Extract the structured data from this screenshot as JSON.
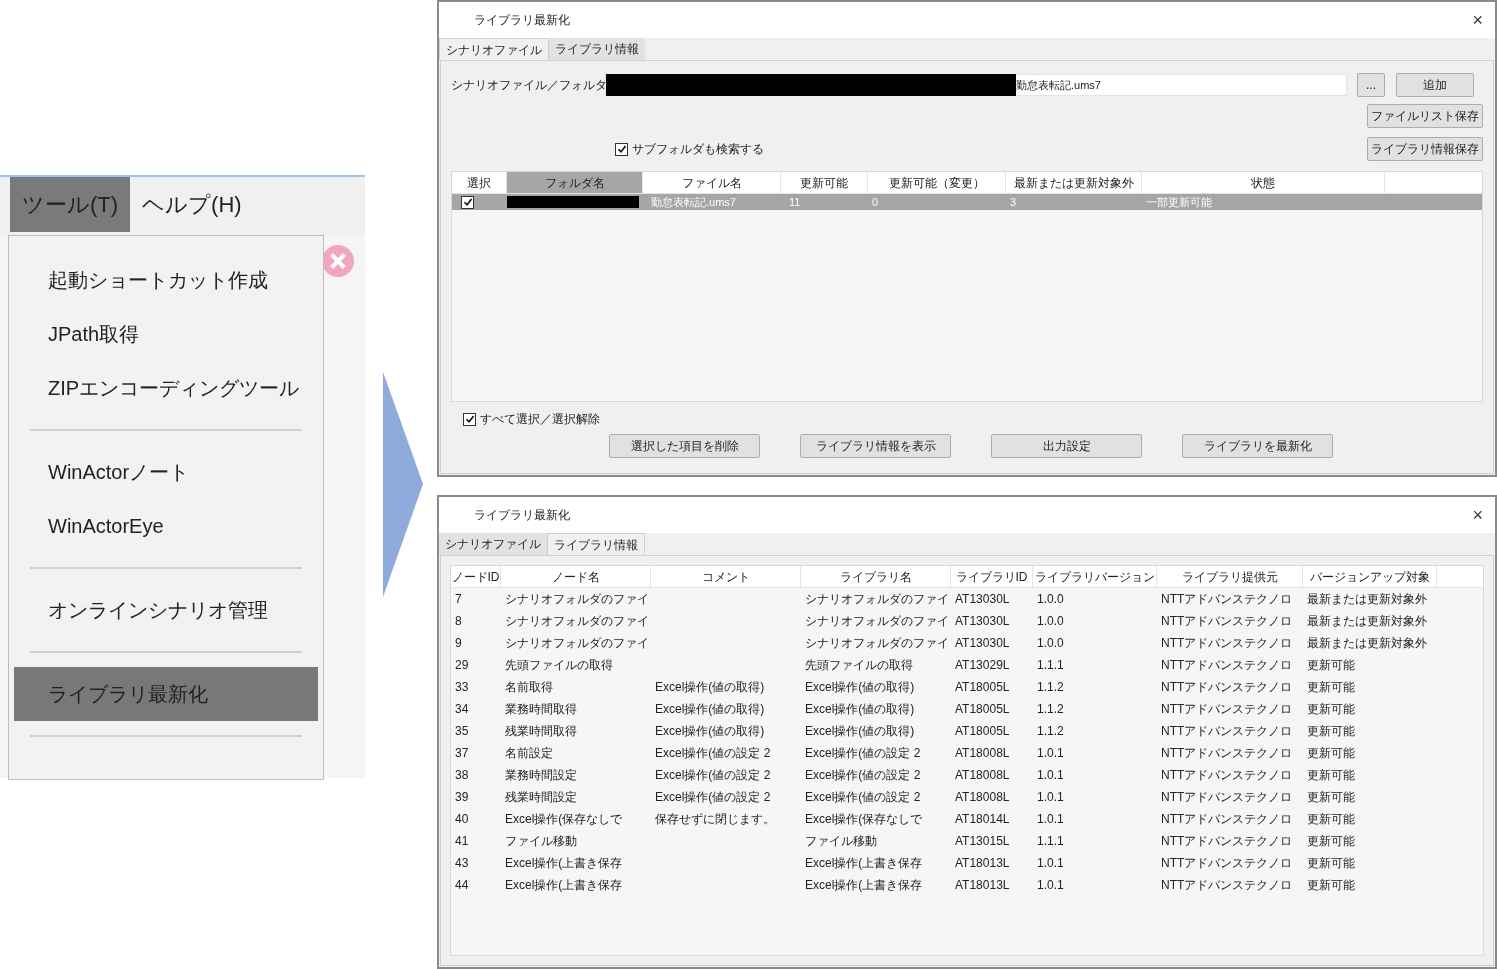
{
  "menu_bar": {
    "items": [
      {
        "label": "ツール(T)",
        "selected": true
      },
      {
        "label": "ヘルプ(H)",
        "selected": false
      }
    ]
  },
  "menu": {
    "items": [
      {
        "kind": "item",
        "label": "起動ショートカット作成",
        "selected": false
      },
      {
        "kind": "item",
        "label": "JPath取得",
        "selected": false
      },
      {
        "kind": "item",
        "label": "ZIPエンコーディングツール",
        "selected": false
      },
      {
        "kind": "separator"
      },
      {
        "kind": "item",
        "label": "WinActorノート",
        "selected": false
      },
      {
        "kind": "item",
        "label": "WinActorEye",
        "selected": false
      },
      {
        "kind": "separator"
      },
      {
        "kind": "item",
        "label": "オンラインシナリオ管理",
        "selected": false
      },
      {
        "kind": "separator"
      },
      {
        "kind": "item",
        "label": "ライブラリ最新化",
        "selected": true
      },
      {
        "kind": "separator"
      }
    ]
  },
  "top_window": {
    "title": "ライブラリ最新化",
    "close": "×",
    "tabs": [
      {
        "label": "シナリオファイル",
        "selected": true
      },
      {
        "label": "ライブラリ情報",
        "selected": false
      }
    ],
    "path_label": "シナリオファイル／フォルダ",
    "path_field": {
      "value": "勤怠表転記.ums7",
      "redacted": true
    },
    "browse_button": "...",
    "add_button": "追加",
    "save_list_button": "ファイルリスト保存",
    "save_info_button": "ライブラリ情報保存",
    "subfolder_checkbox": {
      "label": "サブフォルダも検索する",
      "checked": true
    },
    "table": {
      "columns": [
        {
          "label": "選択",
          "highlighted": false
        },
        {
          "label": "フォルダ名",
          "highlighted": true
        },
        {
          "label": "ファイル名",
          "highlighted": false
        },
        {
          "label": "更新可能",
          "highlighted": false
        },
        {
          "label": "更新可能（変更）",
          "highlighted": false
        },
        {
          "label": "最新または更新対象外",
          "highlighted": false
        },
        {
          "label": "状態",
          "highlighted": false
        }
      ],
      "rows": [
        {
          "checked": true,
          "selected": true,
          "folder_redacted": true,
          "file": "勤怠表転記.ums7",
          "updatable": "11",
          "updatable_changed": "0",
          "latest_or_excluded": "3",
          "status": "一部更新可能"
        }
      ]
    },
    "select_all_checkbox": {
      "label": "すべて選択／選択解除",
      "checked": true
    },
    "buttons": [
      "選択した項目を削除",
      "ライブラリ情報を表示",
      "出力設定",
      "ライブラリを最新化"
    ]
  },
  "bottom_window": {
    "title": "ライブラリ最新化",
    "close": "×",
    "tabs": [
      {
        "label": "シナリオファイル",
        "selected": false
      },
      {
        "label": "ライブラリ情報",
        "selected": true
      }
    ],
    "table": {
      "columns": [
        "ノードID",
        "ノード名",
        "コメント",
        "ライブラリ名",
        "ライブラリID",
        "ライブラリバージョン",
        "ライブラリ提供元",
        "バージョンアップ対象"
      ],
      "rows": [
        [
          "7",
          "シナリオフォルダのファイ",
          "",
          "シナリオフォルダのファイ",
          "AT13030L",
          "1.0.0",
          "NTTアドバンステクノロ",
          "最新または更新対象外"
        ],
        [
          "8",
          "シナリオフォルダのファイ",
          "",
          "シナリオフォルダのファイ",
          "AT13030L",
          "1.0.0",
          "NTTアドバンステクノロ",
          "最新または更新対象外"
        ],
        [
          "9",
          "シナリオフォルダのファイ",
          "",
          "シナリオフォルダのファイ",
          "AT13030L",
          "1.0.0",
          "NTTアドバンステクノロ",
          "最新または更新対象外"
        ],
        [
          "29",
          "先頭ファイルの取得",
          "",
          "先頭ファイルの取得",
          "AT13029L",
          "1.1.1",
          "NTTアドバンステクノロ",
          "更新可能"
        ],
        [
          "33",
          "名前取得",
          "Excel操作(値の取得)",
          "Excel操作(値の取得)",
          "AT18005L",
          "1.1.2",
          "NTTアドバンステクノロ",
          "更新可能"
        ],
        [
          "34",
          "業務時間取得",
          "Excel操作(値の取得)",
          "Excel操作(値の取得)",
          "AT18005L",
          "1.1.2",
          "NTTアドバンステクノロ",
          "更新可能"
        ],
        [
          "35",
          "残業時間取得",
          "Excel操作(値の取得)",
          "Excel操作(値の取得)",
          "AT18005L",
          "1.1.2",
          "NTTアドバンステクノロ",
          "更新可能"
        ],
        [
          "37",
          "名前設定",
          "Excel操作(値の設定 2",
          "Excel操作(値の設定 2",
          "AT18008L",
          "1.0.1",
          "NTTアドバンステクノロ",
          "更新可能"
        ],
        [
          "38",
          "業務時間設定",
          "Excel操作(値の設定 2",
          "Excel操作(値の設定 2",
          "AT18008L",
          "1.0.1",
          "NTTアドバンステクノロ",
          "更新可能"
        ],
        [
          "39",
          "残業時間設定",
          "Excel操作(値の設定 2",
          "Excel操作(値の設定 2",
          "AT18008L",
          "1.0.1",
          "NTTアドバンステクノロ",
          "更新可能"
        ],
        [
          "40",
          "Excel操作(保存なしで",
          "保存せずに閉じます。",
          "Excel操作(保存なしで",
          "AT18014L",
          "1.0.1",
          "NTTアドバンステクノロ",
          "更新可能"
        ],
        [
          "41",
          "ファイル移動",
          "",
          "ファイル移動",
          "AT13015L",
          "1.1.1",
          "NTTアドバンステクノロ",
          "更新可能"
        ],
        [
          "43",
          "Excel操作(上書き保存",
          "",
          "Excel操作(上書き保存",
          "AT18013L",
          "1.0.1",
          "NTTアドバンステクノロ",
          "更新可能"
        ],
        [
          "44",
          "Excel操作(上書き保存",
          "",
          "Excel操作(上書き保存",
          "AT18013L",
          "1.0.1",
          "NTTアドバンステクノロ",
          "更新可能"
        ]
      ]
    }
  }
}
